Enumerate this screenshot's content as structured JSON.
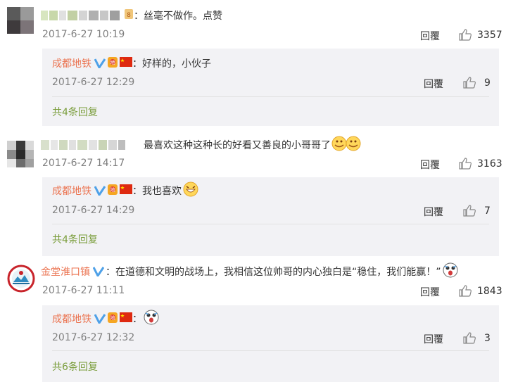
{
  "comments": [
    {
      "text": "丝毫不做作。点赞",
      "time": "2017-6-27 10:19",
      "reply_label": "回覆",
      "likes": "3357",
      "reply": {
        "user": "成都地铁",
        "text": "好样的，小伙子",
        "time": "2017-6-27 12:29",
        "reply_label": "回覆",
        "likes": "9"
      },
      "more": "共4条回复"
    },
    {
      "text": "最喜欢这种这种长的好看又善良的小哥哥了",
      "time": "2017-6-27 14:17",
      "reply_label": "回覆",
      "likes": "3163",
      "reply": {
        "user": "成都地铁",
        "text": "我也喜欢",
        "time": "2017-6-27 14:29",
        "reply_label": "回覆",
        "likes": "7"
      },
      "more": "共4条回复"
    },
    {
      "user": "金堂淮口镇",
      "text": "在道德和文明的战场上，我相信这位帅哥的内心独白是“稳住，我们能赢！”",
      "time": "2017-6-27 11:11",
      "reply_label": "回覆",
      "likes": "1843",
      "reply": {
        "user": "成都地铁",
        "text": "",
        "time": "2017-6-27 12:32",
        "reply_label": "回覆",
        "likes": "3"
      },
      "more": "共6条回复"
    }
  ],
  "colon": "：",
  "colors": {
    "username": "#eb7350",
    "more_link": "#7a9d3b",
    "verified": "#4ea1e8",
    "reply_bg": "#f2f2f5"
  },
  "icons": [
    "thumbs-up-icon",
    "verified-v-icon",
    "china-flag-icon",
    "vip-badge-icon",
    "emoji-icon"
  ]
}
